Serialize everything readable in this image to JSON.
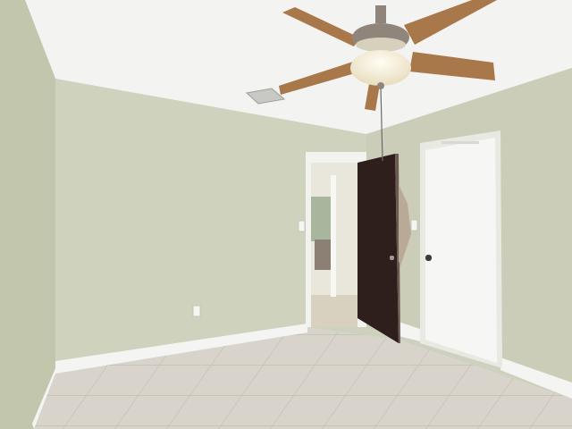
{
  "scene": {
    "colors": {
      "ceiling": "#f3f3f1",
      "wall_left": "#c6cab1",
      "wall_back": "#cfd2bc",
      "wall_right": "#cbcdb8",
      "floor_tile": "#d8d4cb",
      "grout": "#c2beb4",
      "baseboard": "#f4f4f2",
      "door_dark": "#2e1e1c",
      "door_white": "#f6f6f4",
      "fan_blade": "#a8774a",
      "fan_motor": "#8f857a",
      "light_globe": "#f5efdc"
    },
    "objects": [
      "ceiling",
      "ceiling-fan",
      "air-vent",
      "doorway",
      "open-dark-door",
      "closet-door",
      "light-switch",
      "electrical-outlet",
      "baseboard",
      "tile-floor"
    ]
  }
}
